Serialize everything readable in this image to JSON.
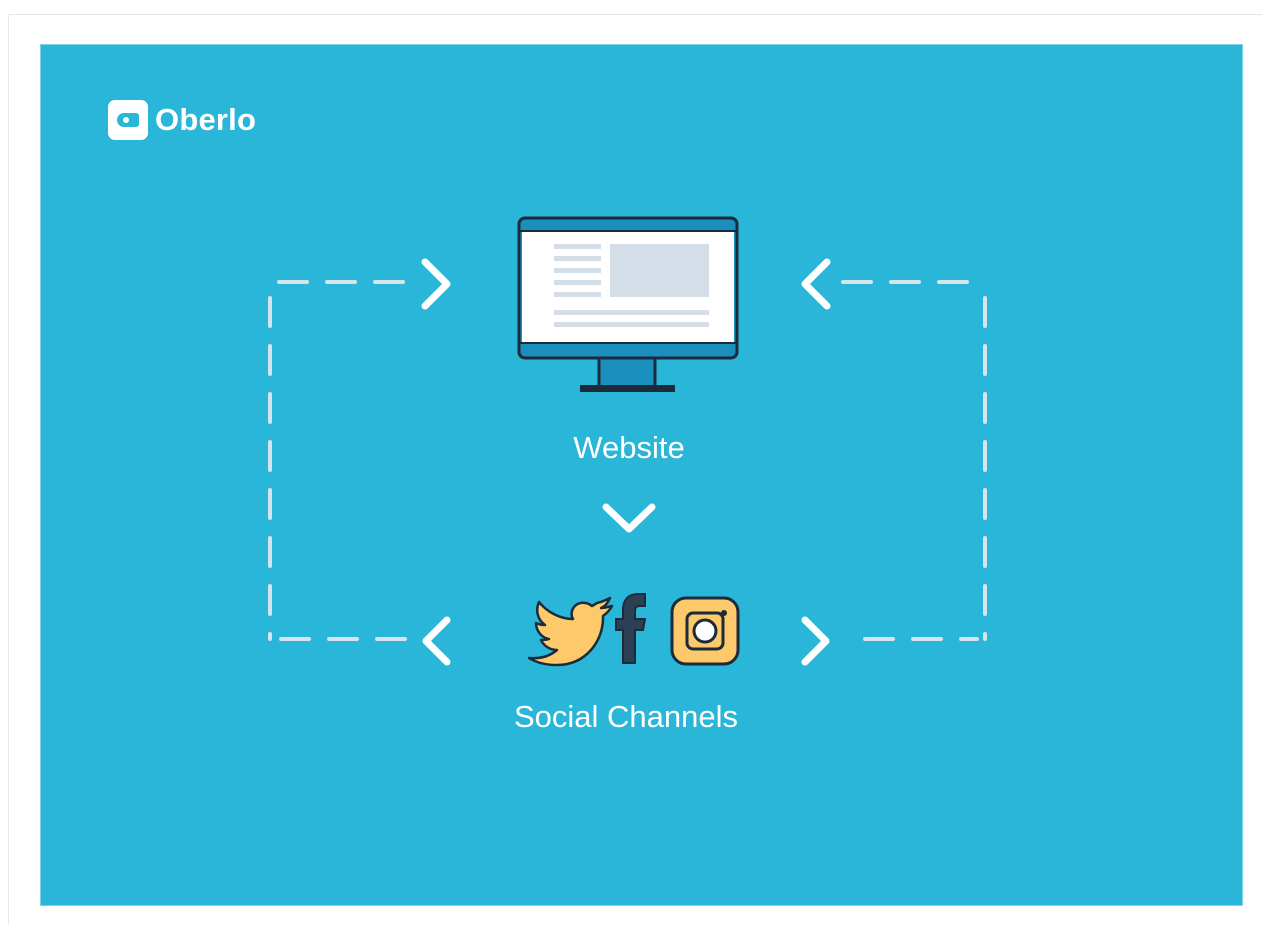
{
  "brand": {
    "name": "Oberlo"
  },
  "nodes": {
    "website_label": "Website",
    "social_label": "Social Channels"
  },
  "icons": {
    "monitor": "monitor-icon",
    "twitter": "twitter-icon",
    "facebook": "facebook-icon",
    "instagram": "instagram-icon",
    "logo": "tag-icon"
  },
  "colors": {
    "panel_bg": "#29b6d9",
    "arrow_white": "#ffffff",
    "dash": "#d6e4ee",
    "twitter": "#fdc96b",
    "facebook": "#2b4055",
    "instagram": "#fdc96b",
    "outline": "#1b2b3a"
  }
}
